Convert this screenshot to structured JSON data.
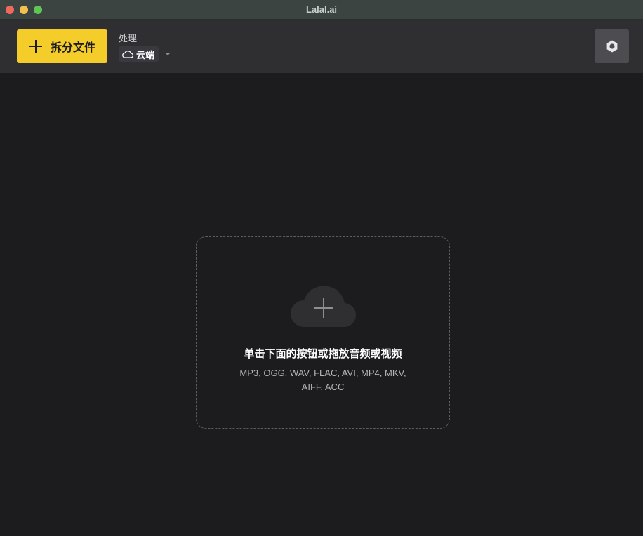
{
  "window": {
    "title": "Lalal.ai"
  },
  "toolbar": {
    "split_button_label": "拆分文件",
    "processing_label": "处理",
    "processing_mode": "云端",
    "icons": {
      "split": "plus-icon",
      "mode": "cloud-icon",
      "mode_dropdown": "chevron-down-icon",
      "settings": "gear-icon"
    }
  },
  "dropzone": {
    "title": "单击下面的按钮或拖放音频或视频",
    "formats_line1": "MP3, OGG, WAV, FLAC, AVI, MP4, MKV,",
    "formats_line2": "AIFF, ACC",
    "icon": "cloud-upload-icon"
  },
  "colors": {
    "accent": "#f5cd2b",
    "background": "#1c1b1e",
    "toolbar": "#2f2e31",
    "titlebar": "#3c4441"
  }
}
